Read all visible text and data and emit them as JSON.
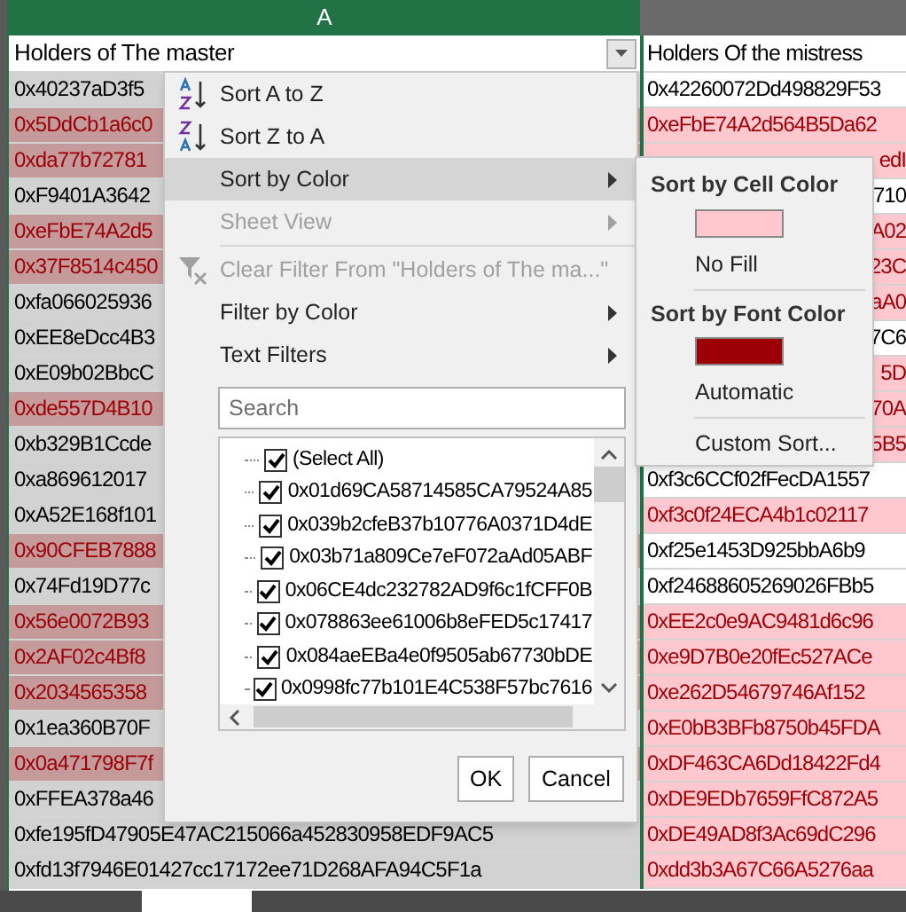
{
  "column_header": {
    "label": "A"
  },
  "column_a": {
    "heading": "Holders of The master",
    "rows": [
      {
        "text": "0x40237aD3f5",
        "highlighted": false
      },
      {
        "text": "0x5DdCb1a6c0",
        "highlighted": true
      },
      {
        "text": "0xda77b72781",
        "highlighted": true
      },
      {
        "text": "0xF9401A3642",
        "highlighted": false
      },
      {
        "text": "0xeFbE74A2d5",
        "highlighted": true
      },
      {
        "text": "0x37F8514c450",
        "highlighted": true
      },
      {
        "text": "0xfa066025936",
        "highlighted": false
      },
      {
        "text": "0xEE8eDcc4B3",
        "highlighted": false
      },
      {
        "text": "0xE09b02BbcC",
        "highlighted": false
      },
      {
        "text": "0xde557D4B10",
        "highlighted": true
      },
      {
        "text": "0xb329B1Ccde",
        "highlighted": false
      },
      {
        "text": "0xa869612017",
        "highlighted": false
      },
      {
        "text": "0xA52E168f101",
        "highlighted": false
      },
      {
        "text": "0x90CFEB7888",
        "highlighted": true
      },
      {
        "text": "0x74Fd19D77c",
        "highlighted": false
      },
      {
        "text": "0x56e0072B93",
        "highlighted": true
      },
      {
        "text": "0x2AF02c4Bf8",
        "highlighted": true
      },
      {
        "text": "0x2034565358",
        "highlighted": true
      },
      {
        "text": "0x1ea360B70F",
        "highlighted": false
      },
      {
        "text": "0x0a471798F7f",
        "highlighted": true
      },
      {
        "text": "0xFFEA378a46",
        "highlighted": false
      },
      {
        "text": "0xfe195fD47905E47AC215066a452830958EDF9AC5",
        "highlighted": false
      },
      {
        "text": "0xfd13f7946E01427cc17172ee71D268AFA94C5F1a",
        "highlighted": false
      }
    ]
  },
  "column_b": {
    "heading": "Holders Of the mistress",
    "rows": [
      {
        "text": "0x42260072Dd498829F53",
        "highlighted": false
      },
      {
        "text": "0xeFbE74A2d564B5Da62",
        "highlighted": true
      },
      {
        "text": "edI",
        "highlighted": true
      },
      {
        "text": "710",
        "highlighted": false
      },
      {
        "text": "A02",
        "highlighted": true
      },
      {
        "text": "23C",
        "highlighted": true
      },
      {
        "text": "aA0",
        "highlighted": true
      },
      {
        "text": "7C6",
        "highlighted": false
      },
      {
        "text": "5D",
        "highlighted": true
      },
      {
        "text": "70A",
        "highlighted": true
      },
      {
        "text": "5B5",
        "highlighted": true
      },
      {
        "text": "0xf3c6CCf02fFecDA1557",
        "highlighted": false
      },
      {
        "text": "0xf3c0f24ECA4b1c02117",
        "highlighted": true
      },
      {
        "text": "0xf25e1453D925bbA6b9",
        "highlighted": false
      },
      {
        "text": "0xf24688605269026FBb5",
        "highlighted": false
      },
      {
        "text": "0xEE2c0e9AC9481d6c96",
        "highlighted": true
      },
      {
        "text": "0xe9D7B0e20fEc527ACe",
        "highlighted": true
      },
      {
        "text": "0xe262D54679746Af152",
        "highlighted": true
      },
      {
        "text": "0xE0bB3BFb8750b45FDA",
        "highlighted": true
      },
      {
        "text": "0xDF463CA6Dd18422Fd4",
        "highlighted": true
      },
      {
        "text": "0xDE9EDb7659FfC872A5",
        "highlighted": true
      },
      {
        "text": "0xDE49AD8f3Ac69dC296",
        "highlighted": true
      },
      {
        "text": "0xdd3b3A67C66A5276aa",
        "highlighted": true
      }
    ]
  },
  "filter_menu": {
    "items": [
      {
        "kind": "sort_asc",
        "label": "Sort A to Z",
        "disabled": false,
        "submenu": false,
        "selected": false
      },
      {
        "kind": "sort_desc",
        "label": "Sort Z to A",
        "disabled": false,
        "submenu": false,
        "selected": false
      },
      {
        "kind": "item",
        "label": "Sort by Color",
        "disabled": false,
        "submenu": true,
        "selected": true
      },
      {
        "kind": "item",
        "label": "Sheet View",
        "disabled": true,
        "submenu": true,
        "selected": false
      },
      {
        "kind": "separator"
      },
      {
        "kind": "clear_filter",
        "label": "Clear Filter From \"Holders of The ma...\"",
        "disabled": true,
        "submenu": false,
        "selected": false
      },
      {
        "kind": "item",
        "label": "Filter by Color",
        "disabled": false,
        "submenu": true,
        "selected": false
      },
      {
        "kind": "item",
        "label": "Text Filters",
        "disabled": false,
        "submenu": true,
        "selected": false
      }
    ],
    "search": {
      "placeholder": "Search"
    },
    "values": [
      {
        "label": "(Select All)",
        "checked": true
      },
      {
        "label": "0x01d69CA58714585CA79524A85",
        "checked": true
      },
      {
        "label": "0x039b2cfeB37b10776A0371D4dE",
        "checked": true
      },
      {
        "label": "0x03b71a809Ce7eF072aAd05ABF",
        "checked": true
      },
      {
        "label": "0x06CE4dc232782AD9f6c1fCFF0B",
        "checked": true
      },
      {
        "label": "0x078863ee61006b8eFED5c17417",
        "checked": true
      },
      {
        "label": "0x084aeEBa4e0f9505ab67730bDE",
        "checked": true
      },
      {
        "label": "0x0998fc77b101E4C538F57bc7616",
        "checked": true
      }
    ],
    "buttons": [
      "OK",
      "Cancel"
    ]
  },
  "color_submenu": {
    "items": [
      {
        "kind": "heading",
        "label": "Sort by Cell Color"
      },
      {
        "kind": "swatch",
        "color": "#ffc7ce"
      },
      {
        "kind": "option",
        "label": "No Fill"
      },
      {
        "kind": "separator"
      },
      {
        "kind": "heading",
        "label": "Sort by Font Color"
      },
      {
        "kind": "swatch",
        "color": "#9c0006"
      },
      {
        "kind": "option",
        "label": "Automatic"
      },
      {
        "kind": "separator"
      },
      {
        "kind": "option",
        "label": "Custom Sort..."
      }
    ]
  }
}
